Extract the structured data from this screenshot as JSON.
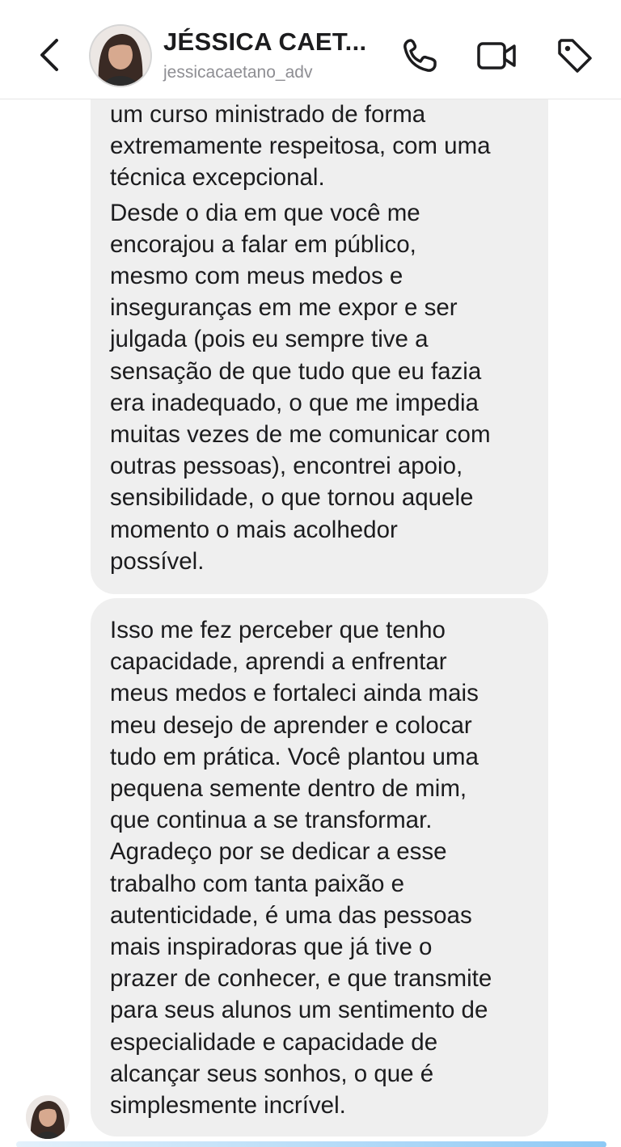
{
  "header": {
    "name": "JÉSSICA CAET...",
    "username": "jessicacaetano_adv",
    "icons": [
      "back-chevron-icon",
      "phone-icon",
      "video-camera-icon",
      "tag-icon"
    ]
  },
  "messages": [
    {
      "paragraphs": [
        "um curso ministrado de forma\nextremamente respeitosa, com uma\ntécnica excepcional.",
        "Desde o dia em que você me\nencorajou a falar em público,\nmesmo com meus medos e\ninseguranças em me expor e ser\njulgada (pois eu sempre tive a\nsensação de que tudo que eu fazia\nera inadequado, o que me impedia\nmuitas vezes de me comunicar com\noutras pessoas), encontrei apoio,\nsensibilidade, o que tornou aquele\nmomento o mais acolhedor\npossível."
      ]
    },
    {
      "paragraphs": [
        "Isso me fez perceber que tenho\ncapacidade, aprendi a enfrentar\nmeus medos e fortaleci ainda mais\nmeu desejo de aprender e colocar\ntudo em prática. Você plantou uma\npequena semente dentro de mim,\nque continua a se transformar.\nAgradeço por se dedicar a esse\ntrabalho com tanta paixão e\nautenticidade, é uma das pessoas\nmais inspiradoras que já tive o\nprazer de conhecer, e que transmite\npara seus alunos um sentimento de\nespecialidade e capacidade de\nalcançar seus sonhos, o que é\nsimplesmente incrível."
      ]
    }
  ],
  "colors": {
    "bubble_bg": "#efefef",
    "text": "#1c1c1e",
    "subtitle": "#8e8e93",
    "outgoing_hint": "#8ec9f5"
  }
}
